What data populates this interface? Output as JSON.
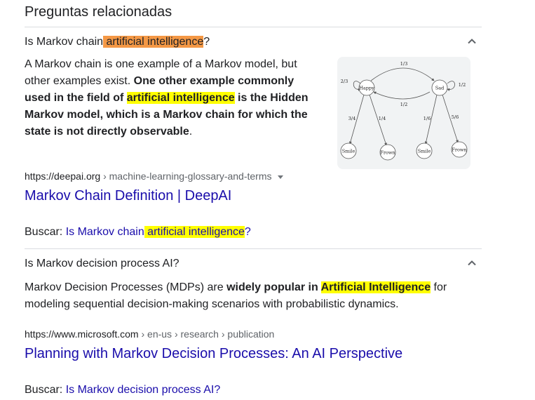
{
  "section_title": "Preguntas relacionadas",
  "q1": {
    "question_pre": "Is Markov chain",
    "question_hl": " artificial intelligence",
    "question_post": "?",
    "answer_1": "A Markov chain is one example of a Markov model, but other examples exist. ",
    "answer_2": "One other example commonly used in the field of ",
    "answer_hl": "artificial intelligence",
    "answer_3": " is the Hidden Markov model, which is a Markov chain for which the state is not directly observable",
    "answer_4": ".",
    "source_domain": "https://deepai.org",
    "source_path": " › machine-learning-glossary-and-terms",
    "result_title": "Markov Chain Definition | DeepAI",
    "search_label": "Buscar: ",
    "search_link_pre": "Is Markov chain",
    "search_link_hl": " artificial intelligence",
    "search_link_post": "?",
    "diagram": {
      "states": [
        "Happy",
        "Sad"
      ],
      "outcomes": [
        "Smile",
        "Frown",
        "Smile",
        "Frown"
      ],
      "labels": {
        "happy_to_sad": "1/3",
        "sad_to_happy": "1/2",
        "happy_self": "2/3",
        "sad_self": "1/2",
        "happy_smile": "3/4",
        "happy_frown": "1/4",
        "sad_smile": "1/6",
        "sad_frown": "5/6"
      }
    }
  },
  "q2": {
    "question": "Is Markov decision process AI?",
    "answer_1": "Markov Decision Processes (MDPs) are ",
    "answer_2": "widely popular in ",
    "answer_hl": "Artificial Intelligence",
    "answer_3": " for modeling sequential decision-making scenarios with probabilistic dynamics.",
    "source_domain": "https://www.microsoft.com",
    "source_path": " › en-us › research › publication",
    "result_title": "Planning with Markov Decision Processes: An AI Perspective",
    "search_label": "Buscar: ",
    "search_link": "Is Markov decision process AI?"
  },
  "colors": {
    "link": "#1a0dab",
    "highlight_orange": "#f49845",
    "highlight_yellow": "#ffff00",
    "divider": "#dadce0"
  },
  "icons": {
    "expand_toggle": "chevron-up-icon",
    "source_menu": "caret-down-icon"
  }
}
